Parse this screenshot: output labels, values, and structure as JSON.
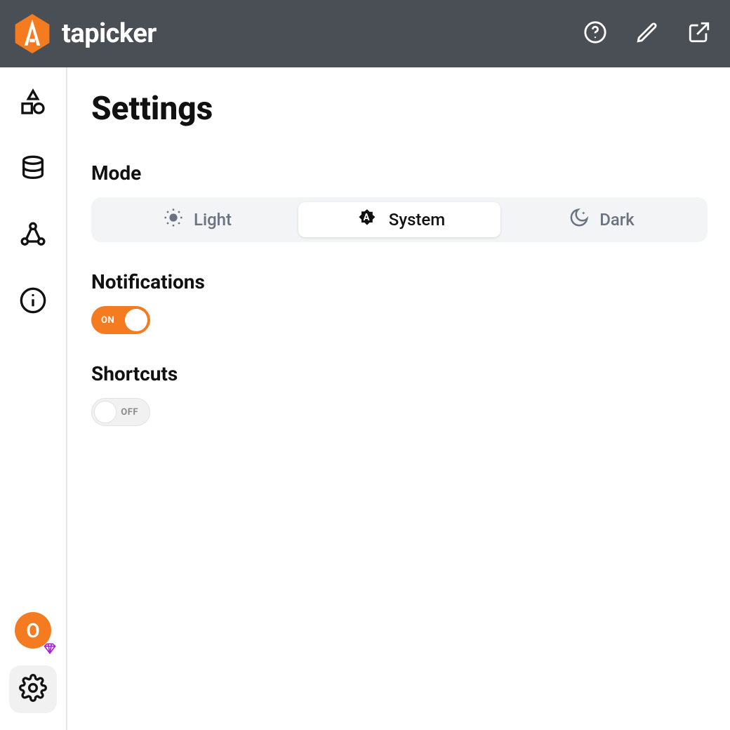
{
  "app": {
    "name": "tapicker"
  },
  "page": {
    "title": "Settings"
  },
  "sections": {
    "mode": {
      "title": "Mode",
      "options": {
        "light": "Light",
        "system": "System",
        "dark": "Dark"
      },
      "selected": "system"
    },
    "notifications": {
      "title": "Notifications",
      "state_label": "ON",
      "on": true
    },
    "shortcuts": {
      "title": "Shortcuts",
      "state_label": "OFF",
      "on": false
    }
  },
  "user": {
    "avatar_letter": "O"
  },
  "colors": {
    "accent": "#f47b20",
    "header": "#4a4f55",
    "premium": "#a821d6"
  }
}
